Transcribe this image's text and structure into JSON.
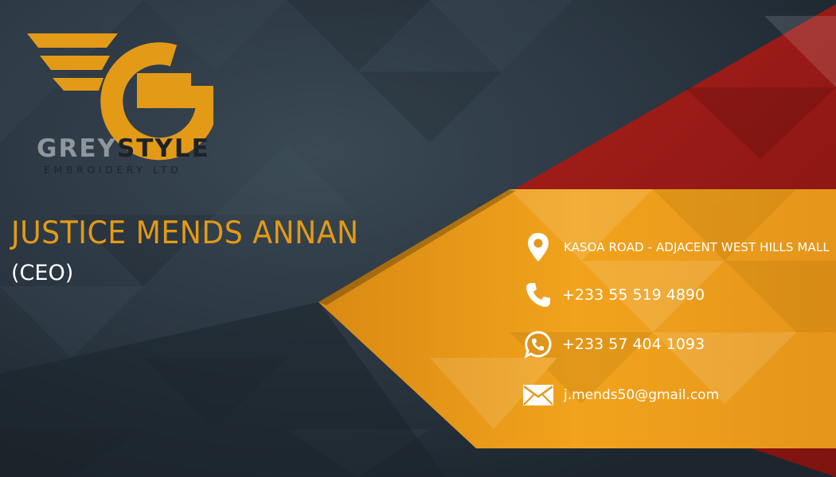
{
  "company": {
    "brand_part1": "GREY",
    "brand_part2": "STYLE",
    "tagline": "EMBROIDERY LTD",
    "logo_icon": "winged-g-logo-icon"
  },
  "person": {
    "name": "JUSTICE MENDS ANNAN",
    "title": "(CEO)"
  },
  "contacts": [
    {
      "icon": "location-pin-icon",
      "text": "KASOA ROAD -  ADJACENT WEST HILLS MALL"
    },
    {
      "icon": "phone-icon",
      "text": "+233 55 519 4890"
    },
    {
      "icon": "whatsapp-icon",
      "text": "+233 57 404 1093"
    },
    {
      "icon": "email-icon",
      "text": "j.mends50@gmail.com"
    }
  ],
  "colors": {
    "background_dark": "#2b3640",
    "accent_orange": "#e39a17",
    "accent_red": "#9c1a16",
    "text_white": "#ffffff"
  }
}
